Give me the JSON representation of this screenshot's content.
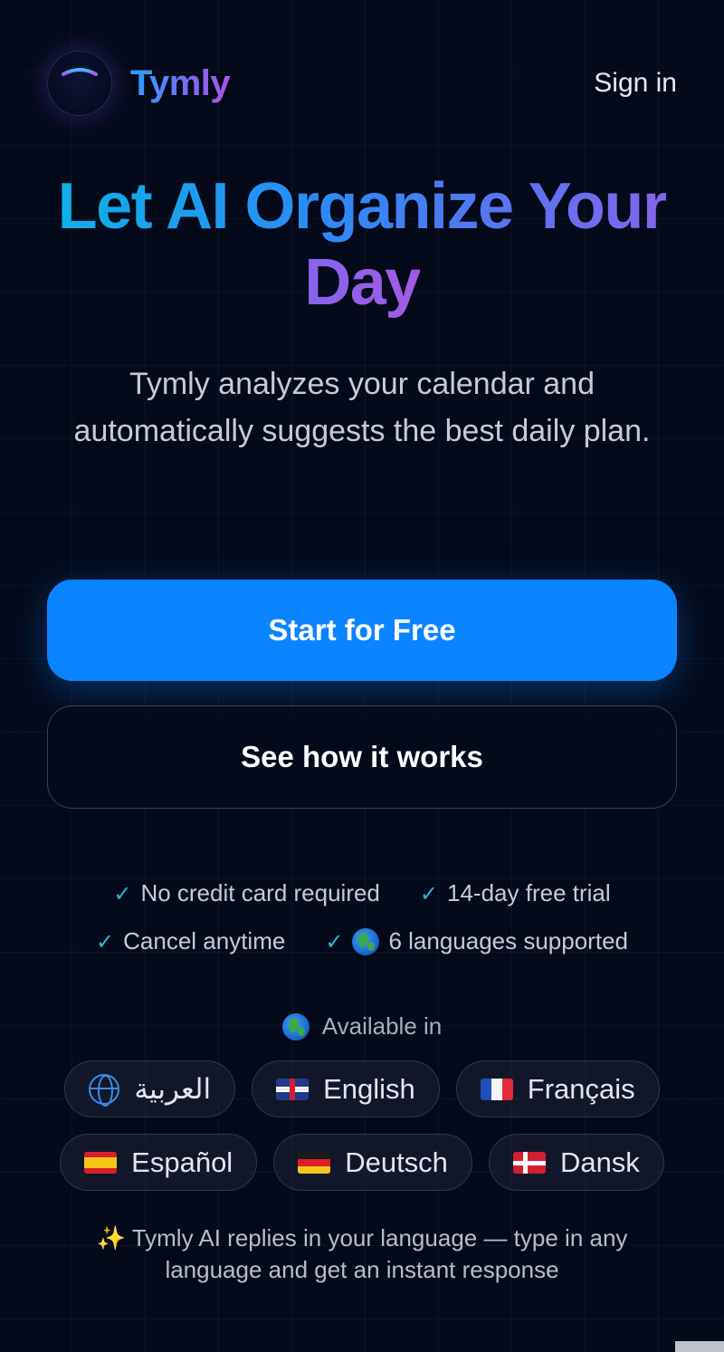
{
  "header": {
    "brand": "Tymly",
    "signin": "Sign in"
  },
  "hero": {
    "title": "Let AI Organize Your Day",
    "subtitle": "Tymly analyzes your calendar and automatically suggests the best daily plan."
  },
  "cta": {
    "primary": "Start for Free",
    "secondary": "See how it works"
  },
  "benefits": {
    "check": "✓",
    "items": [
      "No credit card required",
      "14-day free trial",
      "Cancel anytime",
      "6 languages supported"
    ]
  },
  "languages": {
    "heading": "Available in",
    "items": [
      {
        "label": "العربية",
        "icon": "globe-icon"
      },
      {
        "label": "English",
        "icon": "uk-flag-icon"
      },
      {
        "label": "Français",
        "icon": "france-flag-icon"
      },
      {
        "label": "Español",
        "icon": "spain-flag-icon"
      },
      {
        "label": "Deutsch",
        "icon": "germany-flag-icon"
      },
      {
        "label": "Dansk",
        "icon": "denmark-flag-icon"
      }
    ]
  },
  "footnote": {
    "sparkle": "✨",
    "text": "Tymly AI replies in your language — type in any language and get an instant response"
  },
  "colors": {
    "background": "#050a1a",
    "primary": "#0a84ff",
    "check": "#22b8d6"
  }
}
